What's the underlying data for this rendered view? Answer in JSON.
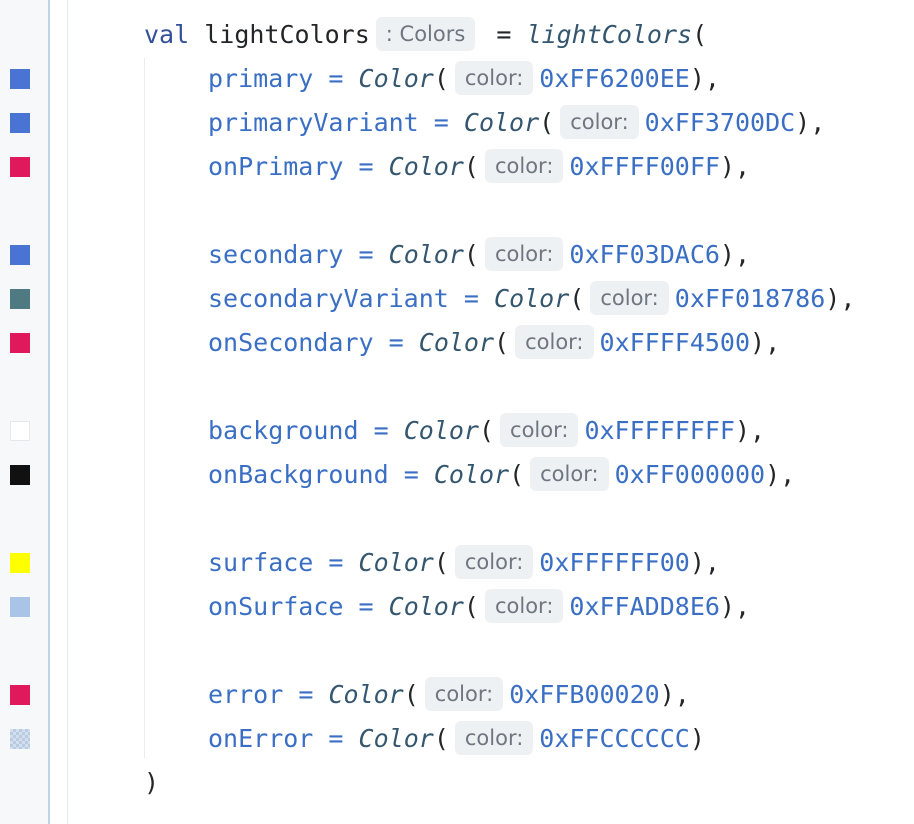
{
  "declaration": {
    "keyword": "val",
    "name": "lightColors",
    "type_hint": ": Colors",
    "equals": "=",
    "function": "lightColors",
    "open_paren": "(",
    "close_paren": ")"
  },
  "param_hint_label": "color:",
  "function_name": "Color",
  "entries": [
    {
      "name": "primary",
      "value": "0xFF6200EE",
      "trailing": "),",
      "swatch": "#4a74d4"
    },
    {
      "name": "primaryVariant",
      "value": "0xFF3700DC",
      "trailing": "),",
      "swatch": "#4a74d4"
    },
    {
      "name": "onPrimary",
      "value": "0xFFFF00FF",
      "trailing": "),",
      "swatch": "#e0195c"
    },
    {
      "name": "secondary",
      "value": "0xFF03DAC6",
      "trailing": "),",
      "swatch": "#4a74d4"
    },
    {
      "name": "secondaryVariant",
      "value": "0xFF018786",
      "trailing": "),",
      "swatch": "#4f7a82"
    },
    {
      "name": "onSecondary",
      "value": "0xFFFF4500",
      "trailing": "),",
      "swatch": "#e0195c"
    },
    {
      "name": "background",
      "value": "0xFFFFFFFF",
      "trailing": "),",
      "swatch": "#ffffff"
    },
    {
      "name": "onBackground",
      "value": "0xFF000000",
      "trailing": "),",
      "swatch": "#111111"
    },
    {
      "name": "surface",
      "value": "0xFFFFFF00",
      "trailing": "),",
      "swatch": "#ffff00"
    },
    {
      "name": "onSurface",
      "value": "0xFFADD8E6",
      "trailing": "),",
      "swatch": "#aac4e8"
    },
    {
      "name": "error",
      "value": "0xFFB00020",
      "trailing": "),",
      "swatch": "#e0195c"
    },
    {
      "name": "onError",
      "value": "0xFFCCCCCC",
      "trailing": ")",
      "swatch": "checker"
    }
  ]
}
